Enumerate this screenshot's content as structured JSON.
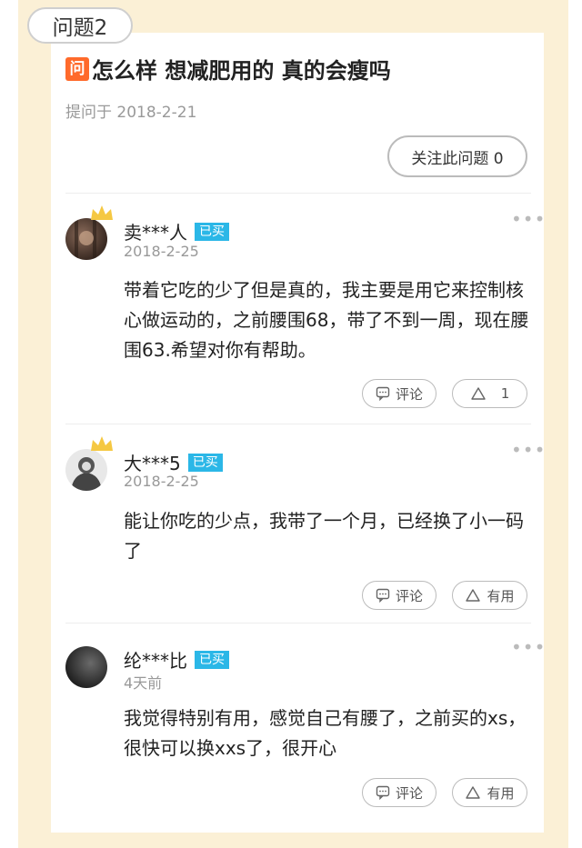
{
  "section_label": "问题2",
  "question": {
    "badge": "问",
    "title": "怎么样 想减肥用的 真的会瘦吗",
    "date": "提问于 2018-2-21",
    "follow_label": "关注此问题 0"
  },
  "answers": [
    {
      "username": "卖***人",
      "badge": "已买",
      "date": "2018-2-25",
      "text": "带着它吃的少了但是真的，我主要是用它来控制核心做运动的，之前腰围68，带了不到一周，现在腰围63.希望对你有帮助。",
      "comment_label": "评论",
      "useful_label": "1",
      "has_crown": true
    },
    {
      "username": "大***5",
      "badge": "已买",
      "date": "2018-2-25",
      "text": "能让你吃的少点，我带了一个月，已经换了小一码了",
      "comment_label": "评论",
      "useful_label": "有用",
      "has_crown": true
    },
    {
      "username": "纶***比",
      "badge": "已买",
      "date": "4天前",
      "text": "我觉得特别有用，感觉自己有腰了，之前买的xs，很快可以换xxs了，很开心",
      "comment_label": "评论",
      "useful_label": "有用",
      "has_crown": false
    }
  ],
  "colors": {
    "background": "#fbf0d6",
    "question_badge": "#ff6a2b",
    "bought_badge": "#2bb7e7"
  },
  "icons": [
    "crown-icon",
    "comment-icon",
    "thumb-up-icon",
    "more-icon"
  ]
}
